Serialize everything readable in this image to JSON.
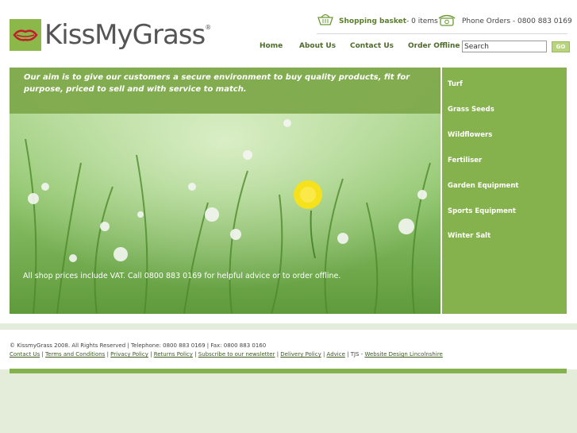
{
  "brand": {
    "name": "KissMyGrass",
    "reg": "®"
  },
  "header": {
    "basket_label": "Shopping basket",
    "basket_count": " - 0 items",
    "phone_text": "Phone Orders - 0800 883 0169"
  },
  "nav": [
    {
      "label": "Home"
    },
    {
      "label": "About Us"
    },
    {
      "label": "Contact Us"
    },
    {
      "label": "Order Offline"
    }
  ],
  "search": {
    "value": "Search",
    "button": "GO"
  },
  "hero": {
    "aim": "Our aim is to give our customers a secure environment to buy quality products, fit for purpose, priced to sell and with service to match.",
    "vat_note": "All shop prices include VAT. Call 0800 883 0169 for helpful advice or to order offline."
  },
  "sidebar": [
    {
      "label": "Turf"
    },
    {
      "label": "Grass Seeds"
    },
    {
      "label": "Wildflowers"
    },
    {
      "label": "Fertiliser"
    },
    {
      "label": "Garden Equipment"
    },
    {
      "label": "Sports Equipment"
    },
    {
      "label": "Winter Salt"
    }
  ],
  "footer": {
    "copyright": "© KissmyGrass 2008. All Rights Reserved | Telephone: 0800 883 0169 | Fax: 0800 883 0160",
    "links": [
      "Contact Us",
      "Terms and Conditions",
      "Privacy Policy",
      "Returns Policy",
      "Subscribe to our newsletter",
      "Delivery Policy",
      "Advice"
    ],
    "tjs": "TJS - ",
    "design_link": "Website Design Lincolnshire"
  },
  "colors": {
    "accent": "#86b24e",
    "nav_text": "#4d6b2a",
    "hero_band": "#7ea94b"
  }
}
